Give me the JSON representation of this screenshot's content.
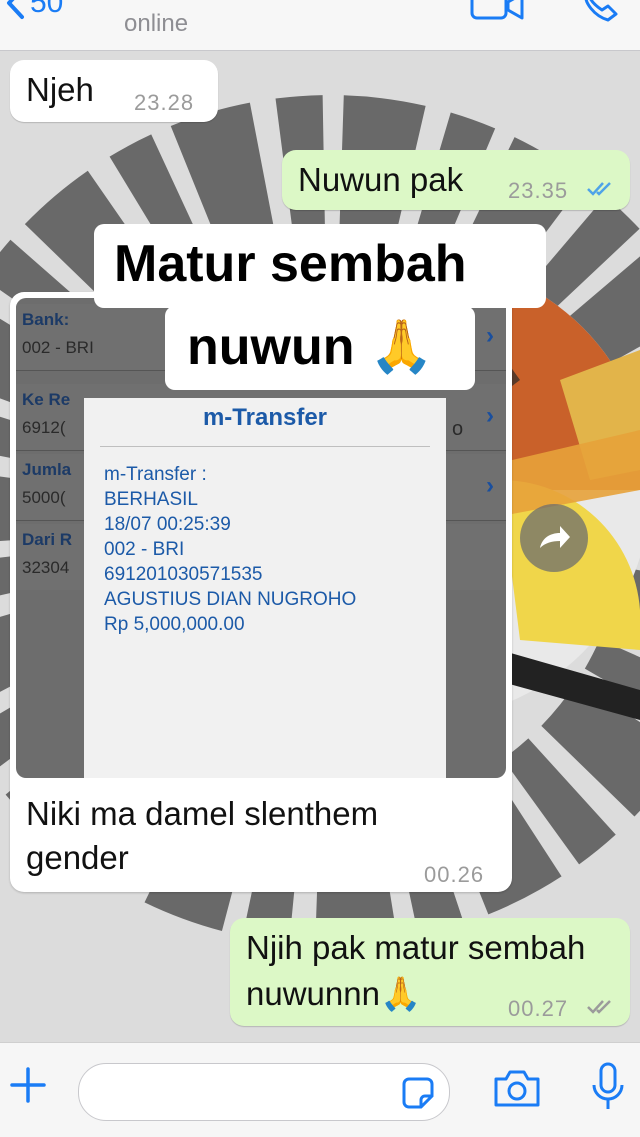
{
  "header": {
    "back_count": "50",
    "status": "online"
  },
  "messages": [
    {
      "text": "Njeh",
      "time": "23.28",
      "direction": "in"
    },
    {
      "text": "Nuwun pak",
      "time": "23.35",
      "direction": "out",
      "read": true
    },
    {
      "caption_line1": "Niki ma damel slenthem",
      "caption_line2": "gender",
      "time": "00.26",
      "direction": "in"
    },
    {
      "text_line1": "Njih pak matur sembah",
      "text_line2": "nuwunnn🙏",
      "time": "00.27",
      "direction": "out",
      "read": true
    }
  ],
  "image_overlay": {
    "line1": "Matur sembah",
    "line2": "nuwun 🙏"
  },
  "image_content": {
    "rows": [
      {
        "label": "Bank:",
        "value": "002 - BRI"
      },
      {
        "label": "Ke Re",
        "value": "6912("
      },
      {
        "label": "Jumla",
        "value": "5000("
      },
      {
        "label": "Dari R",
        "value": "32304"
      }
    ],
    "row_suffix_1": "o",
    "popup_title": "m-Transfer",
    "popup_lines": [
      "m-Transfer :",
      "BERHASIL",
      "18/07 00:25:39",
      "002 - BRI",
      "691201030571535",
      "AGUSTIUS DIAN NUGROHO",
      "Rp 5,000,000.00"
    ]
  },
  "colors": {
    "accent": "#1a7cf5",
    "outgoing_bubble": "#dcf8c6",
    "incoming_bubble": "#ffffff",
    "read_ticks": "#4fa3e8"
  }
}
